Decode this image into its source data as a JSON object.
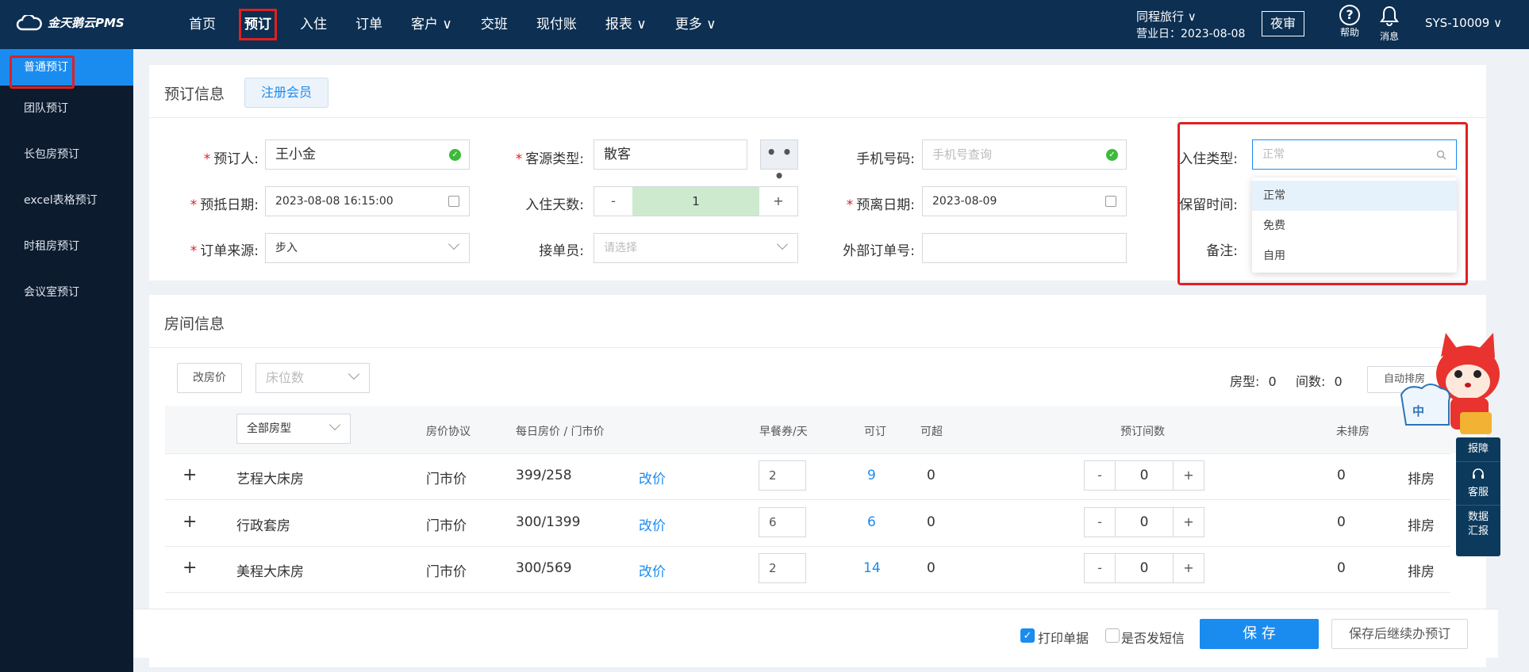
{
  "app": {
    "logo_text": "金天鹅云PMS"
  },
  "nav": [
    {
      "label": "首页",
      "dropdown": false
    },
    {
      "label": "预订",
      "dropdown": false,
      "active": true
    },
    {
      "label": "入住",
      "dropdown": false
    },
    {
      "label": "订单",
      "dropdown": false
    },
    {
      "label": "客户 ∨",
      "dropdown": true
    },
    {
      "label": "交班",
      "dropdown": false
    },
    {
      "label": "现付账",
      "dropdown": false
    },
    {
      "label": "报表 ∨",
      "dropdown": true
    },
    {
      "label": "更多 ∨",
      "dropdown": true
    }
  ],
  "header": {
    "hotel_name": "同程旅行 ∨",
    "business_date": "营业日：2023-08-08",
    "night_audit": "夜审",
    "help_label": "帮助",
    "message_label": "消息",
    "user": "SYS-10009 ∨"
  },
  "sidebar": {
    "items": [
      {
        "label": "普通预订",
        "active": true
      },
      {
        "label": "团队预订"
      },
      {
        "label": "长包房预订"
      },
      {
        "label": "excel表格预订"
      },
      {
        "label": "时租房预订"
      },
      {
        "label": "会议室预订"
      }
    ]
  },
  "booking": {
    "title": "预订信息",
    "register_member": "注册会员",
    "booker_label": "预订人:",
    "booker_value": "王小金",
    "source_type_label": "客源类型:",
    "source_type_value": "散客",
    "more_btn": "• • •",
    "phone_label": "手机号码:",
    "phone_placeholder": "手机号查询",
    "checkin_type_label": "入住类型:",
    "checkin_type_placeholder": "正常",
    "arrival_label": "预抵日期:",
    "arrival_value": "2023-08-08 16:15:00",
    "nights_label": "入住天数:",
    "nights_minus": "-",
    "nights_value": "1",
    "nights_plus": "+",
    "departure_label": "预离日期:",
    "departure_value": "2023-08-09",
    "retain_label": "保留时间:",
    "order_source_label": "订单来源:",
    "order_source_value": "步入",
    "receiver_label": "接单员:",
    "receiver_placeholder": "请选择",
    "external_label": "外部订单号:",
    "note_label": "备注:",
    "checkin_type_options": [
      "正常",
      "免费",
      "自用"
    ]
  },
  "rooms": {
    "title": "房间信息",
    "change_price_btn": "改房价",
    "bed_count_placeholder": "床位数",
    "room_type_label": "房型:",
    "room_type_count": "0",
    "room_count_label": "间数:",
    "room_count_value": "0",
    "auto_assign_btn": "自动排房",
    "headers": {
      "all_types": "全部房型",
      "agreement": "房价协议",
      "daily_price": "每日房价 / 门市价",
      "breakfast": "早餐券/天",
      "available": "可订",
      "over": "可超",
      "booked": "预订间数",
      "unassigned": "未排房"
    },
    "rows": [
      {
        "expand": "+",
        "name": "艺程大床房",
        "agreement": "门市价",
        "price": "399/258",
        "edit": "改价",
        "breakfast": "2",
        "available": "9",
        "over": "0",
        "minus": "-",
        "count": "0",
        "plus": "+",
        "unassigned": "0",
        "assign": "排房"
      },
      {
        "expand": "+",
        "name": "行政套房",
        "agreement": "门市价",
        "price": "300/1399",
        "edit": "改价",
        "breakfast": "6",
        "available": "6",
        "over": "0",
        "minus": "-",
        "count": "0",
        "plus": "+",
        "unassigned": "0",
        "assign": "排房"
      },
      {
        "expand": "+",
        "name": "美程大床房",
        "agreement": "门市价",
        "price": "300/569",
        "edit": "改价",
        "breakfast": "2",
        "available": "14",
        "over": "0",
        "minus": "-",
        "count": "0",
        "plus": "+",
        "unassigned": "0",
        "assign": "排房"
      }
    ]
  },
  "footer": {
    "print_label": "打印单据",
    "print_checked": true,
    "sms_label": "是否发短信",
    "sms_checked": false,
    "save": "保 存",
    "save_continue": "保存后继续办预订"
  },
  "float": {
    "report": "报障",
    "service": "客服",
    "data": "数据",
    "summary": "汇报",
    "mascot_badge": "中"
  },
  "colors": {
    "topbar": "#0c2f52",
    "sidebar": "#0c1b2e",
    "accent": "#1a8cf0",
    "highlight": "#e02020",
    "success": "#3cba3c"
  }
}
